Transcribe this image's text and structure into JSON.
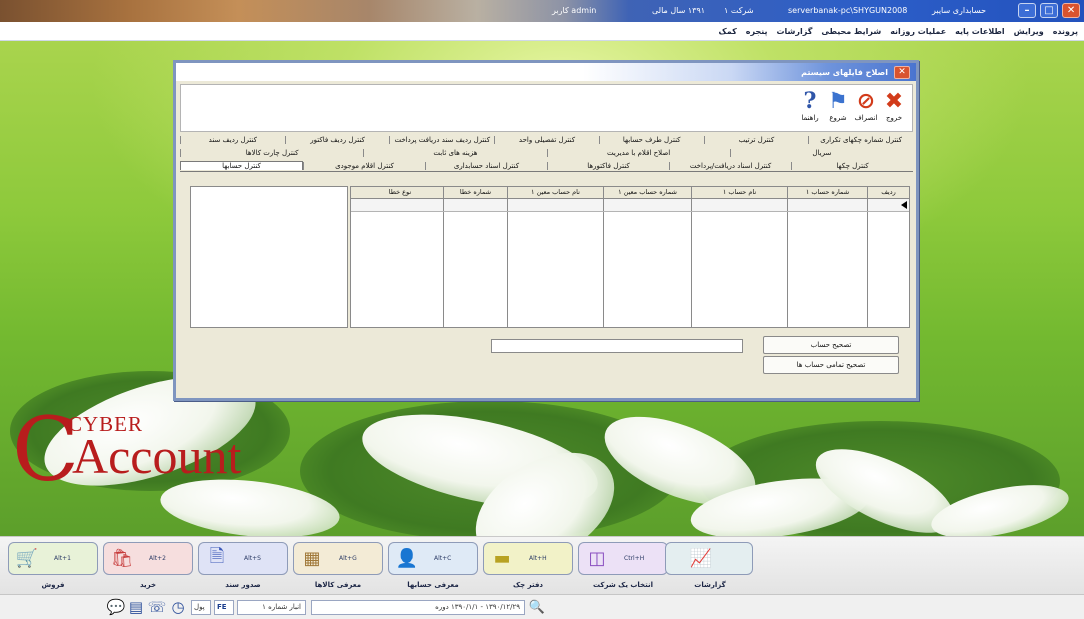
{
  "titlebar": {
    "app_title": "حسابداری سایبر",
    "server": "serverbanak-pc\\SHYGUN2008",
    "company_label": "شرکت ۱",
    "year_label": "۱۳۹۱ سال مالی",
    "user": "admin کاربر",
    "close_glyph": "✕",
    "maximize_glyph": "□",
    "minimize_glyph": "–"
  },
  "menu": [
    "پرونده",
    "ویرایش",
    "اطلاعات پایه",
    "عملیات روزانه",
    "شرایط محیطی",
    "گزارشات",
    "پنجره",
    "کمک"
  ],
  "dialog": {
    "title": "اصلاح فایلهای سیستم",
    "toolbar": [
      {
        "label": "خروج",
        "icon": "exit-icon"
      },
      {
        "label": "انصراف",
        "icon": "cancel-icon"
      },
      {
        "label": "شروع",
        "icon": "start-flag-icon"
      },
      {
        "label": "راهنما",
        "icon": "help-icon"
      }
    ],
    "tabs_row1": [
      "کنترل شماره چکهای تکراری",
      "کنترل ترتیب",
      "کنترل طرف حسابها",
      "کنترل تفصیلی واحد",
      "کنترل ردیف سند دریافت پرداخت",
      "کنترل ردیف فاکتور",
      "کنترل ردیف سند"
    ],
    "tabs_row2": [
      "سریال",
      "اصلاح اقلام با مدیریت",
      "هزینه های ثابت",
      "کنترل چارت کالاها"
    ],
    "tabs_row3": [
      "کنترل چکها",
      "کنترل اسناد دریافت/پرداخت",
      "کنترل فاکتورها",
      "کنترل اسناد حسابداری",
      "کنترل اقلام موجودی",
      "کنترل حسابها"
    ],
    "active_tab": "کنترل حسابها",
    "grid_columns": [
      "ردیف",
      "شماره حساب ۱",
      "نام حساب ۱",
      "شماره حساب معین ۱",
      "نام حساب معین ۱",
      "شماره خطا",
      "نوع خطا"
    ],
    "btn_fix": "تصحیح حساب",
    "btn_fix_all": "تصحیح تمامی حساب ها"
  },
  "logo": {
    "c_letter": "C",
    "cyber": "CYBER",
    "account": "Account"
  },
  "shortcuts": [
    {
      "label": "فروش",
      "key": "Alt+1",
      "icon": "cart-icon",
      "color": "#e8f2d8"
    },
    {
      "label": "خرید",
      "key": "Alt+2",
      "icon": "purchase-icon",
      "color": "#f6dede"
    },
    {
      "label": "صدور سند",
      "key": "Alt+S",
      "icon": "document-icon",
      "color": "#dfe3f6"
    },
    {
      "label": "معرفی کالاها",
      "key": "Alt+G",
      "icon": "goods-icon",
      "color": "#f3ebd6"
    },
    {
      "label": "معرفی حسابها",
      "key": "Alt+C",
      "icon": "accounts-icon",
      "color": "#dfeaf6"
    },
    {
      "label": "دفتر چک",
      "key": "Alt+H",
      "icon": "cheque-icon",
      "color": "#f2f2c8"
    },
    {
      "label": "انتخاب یک شرکت",
      "key": "Ctrl+H",
      "icon": "company-icon",
      "color": "#ece1f6"
    },
    {
      "label": "گزارشات",
      "key": "",
      "icon": "report-icon",
      "color": "#e4eef0"
    }
  ],
  "statusbar": {
    "date_field": "۱۳۹۰/۱۲/۲۹ - ۱۳۹۰/۱/۱ دوره",
    "warehouse_field": "انبار شماره ۱",
    "lang": "FE",
    "mode": "پول"
  }
}
